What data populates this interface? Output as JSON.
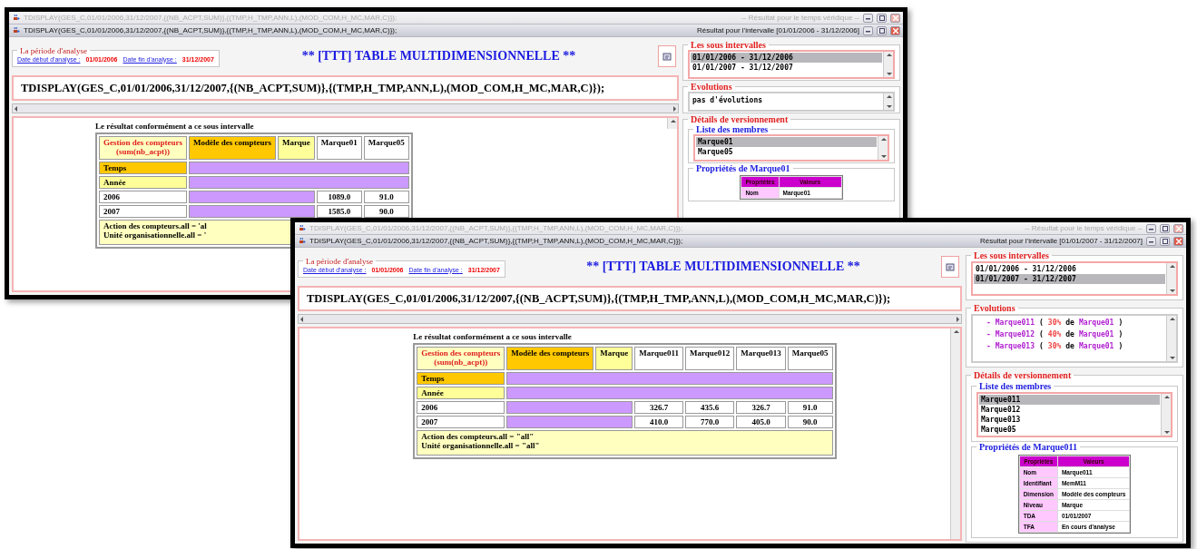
{
  "windows": [
    {
      "title_bars": [
        {
          "text": "TDISPLAY(GES_C,01/01/2006,31/12/2007,{(NB_ACPT,SUM)},{(TMP,H_TMP,ANN,L),(MOD_COM,H_MC,MAR,C)});",
          "status": "-- Résultat pour le temps véridique --",
          "active": false
        },
        {
          "text": "TDISPLAY(GES_C,01/01/2006,31/12/2007,{(NB_ACPT,SUM)},{(TMP,H_TMP,ANN,L),(MOD_COM,H_MC,MAR,C)});",
          "status": "Résultat pour l'intervalle [01/01/2006 - 31/12/2006]",
          "active": true
        }
      ],
      "period": {
        "legend": "La période d'analyse",
        "start_label": "Date début d'analyse :",
        "start": "01/01/2006",
        "end_label": "Date fin d'analyse :",
        "end": "31/12/2007"
      },
      "heading": "** [TTT] TABLE MULTIDIMENSIONNELLE **",
      "query": "TDISPLAY(GES_C,01/01/2006,31/12/2007,{(NB_ACPT,SUM)},{(TMP,H_TMP,ANN,L),(MOD_COM,H_MC,MAR,C)});",
      "result": {
        "caption": "Le résultat conformément a ce sous intervalle",
        "corner": [
          "Gestion des compteurs",
          "(sum(nb_acpt))"
        ],
        "dimension": "Modèle des compteurs",
        "level": "Marque",
        "members": [
          "Marque01",
          "Marque05"
        ],
        "time": "Temps",
        "time_level": "Année",
        "rows": [
          {
            "label": "2006",
            "values": [
              "1089.0",
              "91.0"
            ]
          },
          {
            "label": "2007",
            "values": [
              "1585.0",
              "90.0"
            ]
          }
        ],
        "footer": [
          "Action des compteurs.all = 'al",
          "Unité organisationnelle.all = '"
        ]
      },
      "sub_intervals": {
        "legend": "Les sous intervalles",
        "items": [
          {
            "text": "01/01/2006 - 31/12/2006",
            "selected": true
          },
          {
            "text": "01/01/2007 - 31/12/2007",
            "selected": false
          }
        ]
      },
      "evolutions": {
        "legend": "Evolutions",
        "items": [
          {
            "parts": [
              {
                "text": "pas d'évolutions",
                "kind": "plain"
              }
            ]
          }
        ]
      },
      "versioning": {
        "legend": "Détails de versionnement",
        "members_legend": "Liste des membres",
        "members": [
          {
            "text": "Marque01",
            "selected": true
          },
          {
            "text": "Marque05",
            "selected": false
          }
        ],
        "properties_legend": "Propriétés de Marque01",
        "properties_header": [
          "Propriétés",
          "Valeurs"
        ],
        "properties": [
          {
            "name": "Nom",
            "value": "Marque01"
          }
        ]
      }
    },
    {
      "title_bars": [
        {
          "text": "TDISPLAY(GES_C,01/01/2006,31/12/2007,{(NB_ACPT,SUM)},{(TMP,H_TMP,ANN,L),(MOD_COM,H_MC,MAR,C)});",
          "status": "-- Résultat pour le temps véridique --",
          "active": false
        },
        {
          "text": "TDISPLAY(GES_C,01/01/2006,31/12/2007,{(NB_ACPT,SUM)},{(TMP,H_TMP,ANN,L),(MOD_COM,H_MC,MAR,C)});",
          "status": "Résultat pour l'intervalle [01/01/2007 - 31/12/2007]",
          "active": true
        }
      ],
      "period": {
        "legend": "La période d'analyse",
        "start_label": "Date début d'analyse :",
        "start": "01/01/2006",
        "end_label": "Date fin d'analyse :",
        "end": "31/12/2007"
      },
      "heading": "** [TTT] TABLE MULTIDIMENSIONNELLE **",
      "query": "TDISPLAY(GES_C,01/01/2006,31/12/2007,{(NB_ACPT,SUM)},{(TMP,H_TMP,ANN,L),(MOD_COM,H_MC,MAR,C)});",
      "result": {
        "caption": "Le résultat conformément a ce sous intervalle",
        "corner": [
          "Gestion des compteurs",
          "(sum(nb_acpt))"
        ],
        "dimension": "Modèle des compteurs",
        "level": "Marque",
        "members": [
          "Marque011",
          "Marque012",
          "Marque013",
          "Marque05"
        ],
        "time": "Temps",
        "time_level": "Année",
        "rows": [
          {
            "label": "2006",
            "values": [
              "326.7",
              "435.6",
              "326.7",
              "91.0"
            ]
          },
          {
            "label": "2007",
            "values": [
              "410.0",
              "770.0",
              "405.0",
              "90.0"
            ]
          }
        ],
        "footer": [
          "Action des compteurs.all = \"all\"",
          "Unité organisationnelle.all = \"all\""
        ]
      },
      "sub_intervals": {
        "legend": "Les sous intervalles",
        "items": [
          {
            "text": "01/01/2006 - 31/12/2006",
            "selected": false
          },
          {
            "text": "01/01/2007 - 31/12/2007",
            "selected": true
          }
        ]
      },
      "evolutions": {
        "legend": "Evolutions",
        "items": [
          {
            "parts": [
              {
                "text": "- Marque011",
                "kind": "member"
              },
              {
                "text": "(",
                "kind": "plain"
              },
              {
                "text": "30%",
                "kind": "percent"
              },
              {
                "text": "de",
                "kind": "plain"
              },
              {
                "text": "Marque01",
                "kind": "member"
              },
              {
                "text": ")",
                "kind": "plain"
              }
            ]
          },
          {
            "parts": [
              {
                "text": "- Marque012",
                "kind": "member"
              },
              {
                "text": "(",
                "kind": "plain"
              },
              {
                "text": "40%",
                "kind": "percent"
              },
              {
                "text": "de",
                "kind": "plain"
              },
              {
                "text": "Marque01",
                "kind": "member"
              },
              {
                "text": ")",
                "kind": "plain"
              }
            ]
          },
          {
            "parts": [
              {
                "text": "- Marque013",
                "kind": "member"
              },
              {
                "text": "(",
                "kind": "plain"
              },
              {
                "text": "30%",
                "kind": "percent"
              },
              {
                "text": "de",
                "kind": "plain"
              },
              {
                "text": "Marque01",
                "kind": "member"
              },
              {
                "text": ")",
                "kind": "plain"
              }
            ]
          }
        ]
      },
      "versioning": {
        "legend": "Détails de versionnement",
        "members_legend": "Liste des membres",
        "members": [
          {
            "text": "Marque011",
            "selected": true
          },
          {
            "text": "Marque012",
            "selected": false
          },
          {
            "text": "Marque013",
            "selected": false
          },
          {
            "text": "Marque05",
            "selected": false
          }
        ],
        "properties_legend": "Propriétés de Marque011",
        "properties_header": [
          "Propriétés",
          "Valeurs"
        ],
        "properties": [
          {
            "name": "Nom",
            "value": "Marque011"
          },
          {
            "name": "Identifiant",
            "value": "MemM11"
          },
          {
            "name": "Dimension",
            "value": "Modèle des compteurs"
          },
          {
            "name": "Niveau",
            "value": "Marque"
          },
          {
            "name": "TDA",
            "value": "01/01/2007"
          },
          {
            "name": "TFA",
            "value": "En cours d'analyse"
          }
        ]
      }
    }
  ]
}
